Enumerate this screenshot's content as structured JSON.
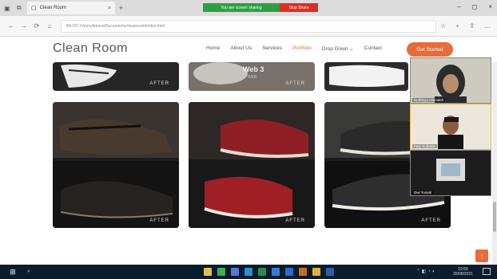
{
  "browser": {
    "tab_title": "Clean Room",
    "tab_close": "×",
    "new_tab": "+",
    "share_text": "You are screen sharing",
    "stop_share": "Stop Share",
    "url": "file:///C:/Users/lenovo/Documents/cleanroom/index.html",
    "window_controls": [
      "–",
      "◻",
      "×"
    ],
    "nav_icons": [
      "←",
      "→",
      "⟳",
      "⌂"
    ],
    "toolbar_icons": [
      "☆",
      "⋆",
      "⇪",
      "…"
    ]
  },
  "site": {
    "logo": "Clean Room",
    "menu": [
      "Home",
      "About Us",
      "Services",
      "Portfolio",
      "Drop Down ⌄",
      "Contact"
    ],
    "active_menu": "Portfolio",
    "cta": "Get Started",
    "accent_color": "#e96b39"
  },
  "portfolio": {
    "brand_label": "AFTER",
    "featured_title": "Web 3",
    "featured_sub": "WEB"
  },
  "video_call": {
    "participants": [
      "Nurfitriya Hamidah",
      "Fery Subanto",
      "Dwi Yuniati"
    ]
  },
  "taskbar": {
    "time": "19:55",
    "date": "30/08/2021",
    "search_icon": "⌕",
    "start_icon": "⊞",
    "back_to_top": "↑"
  }
}
